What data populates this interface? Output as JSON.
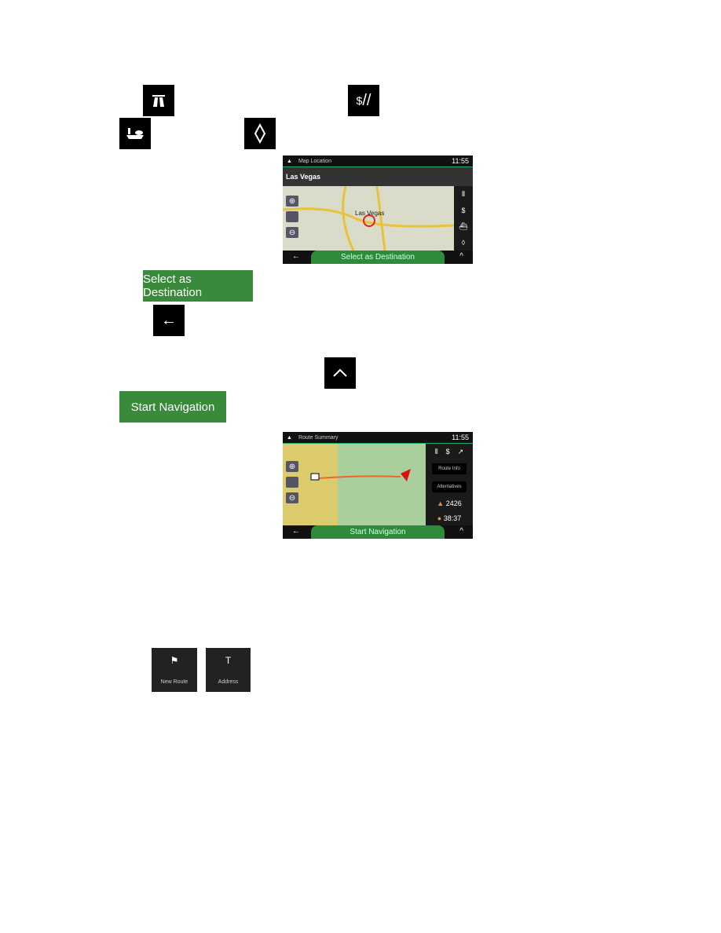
{
  "icons": {
    "motorway": "motorway-icon",
    "toll": "toll-road-icon",
    "ferry": "ferry-icon",
    "other": "diamond-icon",
    "back": "←",
    "up": "^"
  },
  "buttons": {
    "select_destination": "Select as Destination",
    "start_navigation": "Start Navigation"
  },
  "screen1": {
    "title": "Map Location",
    "time": "11:55",
    "place": "Las Vegas",
    "map_label": "Las Vegas",
    "bottom_button": "Select as Destination"
  },
  "screen2": {
    "title": "Route Summary",
    "time": "11:55",
    "route_info": "Route Info",
    "alternatives": "Alternatives",
    "distance": "2426",
    "duration": "38:37",
    "bottom_button": "Start Navigation"
  },
  "tiles": {
    "new_route": "New Route",
    "address": "Address"
  }
}
